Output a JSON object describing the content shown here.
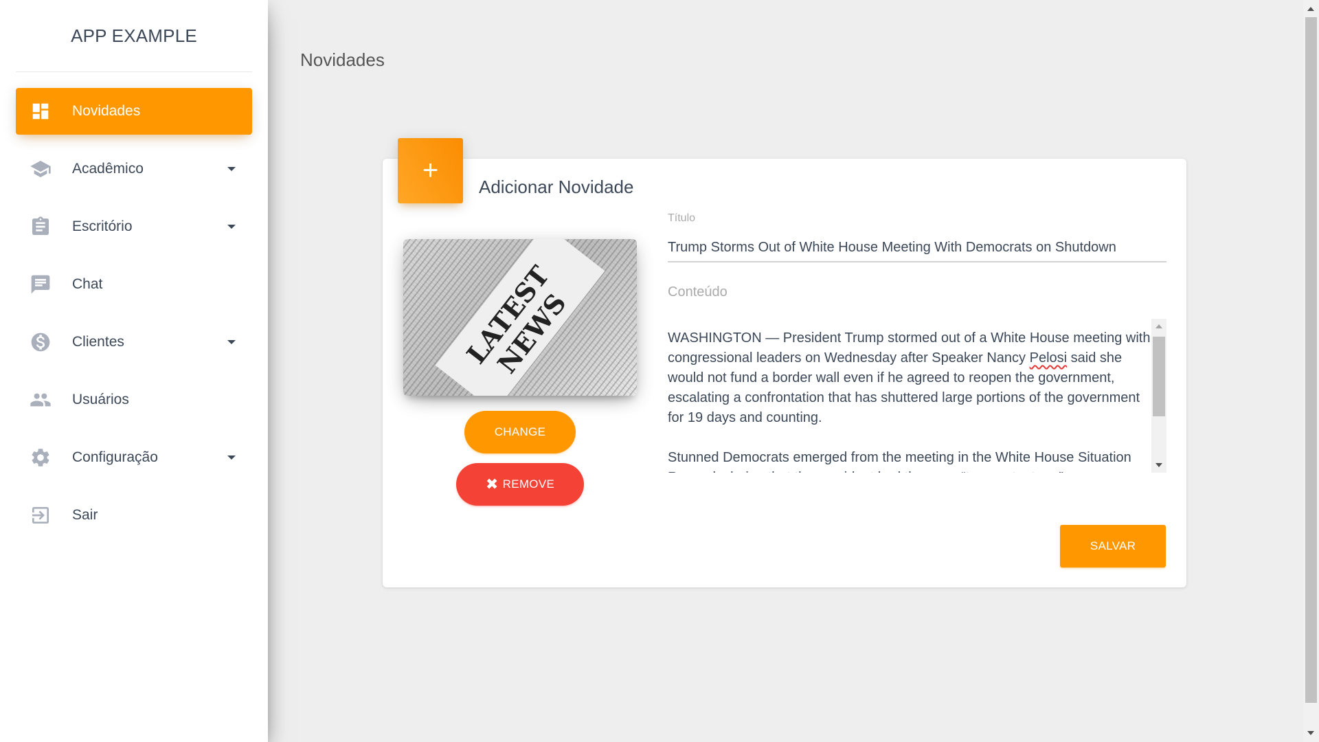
{
  "app": {
    "brand": "APP EXAMPLE"
  },
  "sidebar": {
    "items": [
      {
        "label": "Novidades",
        "icon": "dashboard-icon",
        "active": true,
        "has_submenu": false
      },
      {
        "label": "Acadêmico",
        "icon": "graduation-cap-icon",
        "active": false,
        "has_submenu": true
      },
      {
        "label": "Escritório",
        "icon": "clipboard-icon",
        "active": false,
        "has_submenu": true
      },
      {
        "label": "Chat",
        "icon": "chat-icon",
        "active": false,
        "has_submenu": false
      },
      {
        "label": "Clientes",
        "icon": "dollar-icon",
        "active": false,
        "has_submenu": true
      },
      {
        "label": "Usuários",
        "icon": "people-icon",
        "active": false,
        "has_submenu": false
      },
      {
        "label": "Configuração",
        "icon": "gear-icon",
        "active": false,
        "has_submenu": true
      },
      {
        "label": "Sair",
        "icon": "exit-icon",
        "active": false,
        "has_submenu": false
      }
    ]
  },
  "page": {
    "title": "Novidades"
  },
  "form": {
    "header_icon": "plus-icon",
    "header_symbol": "+",
    "title": "Adicionar Novidade",
    "image_text": "LATEST NEWS",
    "change_label": "CHANGE",
    "remove_label": "REMOVE",
    "remove_symbol": "✖",
    "titulo_label": "Título",
    "titulo_value": "Trump Storms Out of White House Meeting With Democrats on Shutdown",
    "conteudo_label": "Conteúdo",
    "conteudo_p1_before": "WASHINGTON — President Trump stormed out of a White House meeting with congressional leaders on Wednesday after Speaker Nancy ",
    "conteudo_p1_pelosi": "Pelosi",
    "conteudo_p1_after": " said she would not fund a border wall even if he agreed to reopen the government, escalating a confrontation that has shuttered large portions of the government for 19 days and counting.",
    "conteudo_p2": "Stunned Democrats emerged from the meeting in the White House Situation Room declaring that the president had thrown a “temper tantrum”",
    "save_label": "SALVAR"
  },
  "colors": {
    "accent": "#ff9800",
    "danger": "#f44336",
    "background": "#eeeeee",
    "text": "#3c4858"
  }
}
